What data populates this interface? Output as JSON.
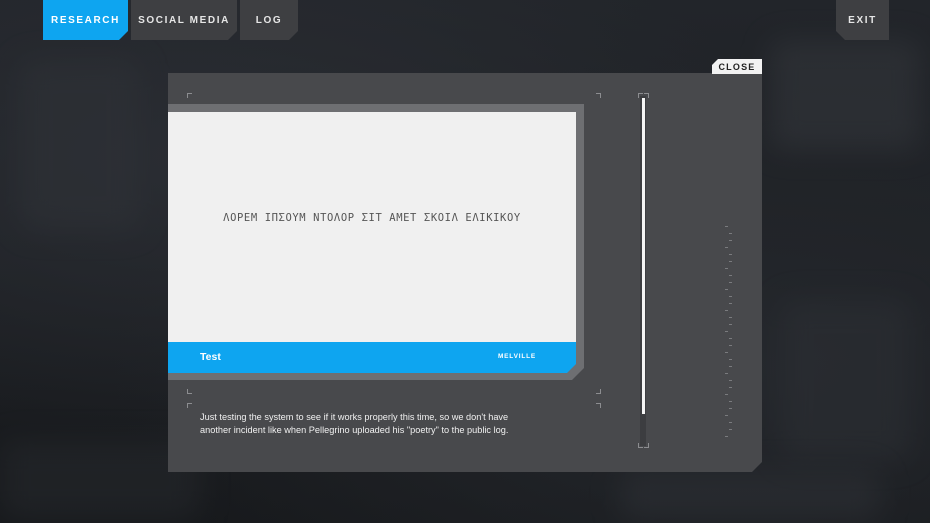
{
  "nav": {
    "tabs": [
      {
        "label": "RESEARCH",
        "active": true
      },
      {
        "label": "SOCIAL MEDIA",
        "active": false
      },
      {
        "label": "LOG",
        "active": false
      }
    ],
    "exit_label": "EXIT"
  },
  "modal": {
    "close_label": "CLOSE",
    "post": {
      "image_text": "ΛΟΡΕΜ ΙΠΣΟΥΜ ΝΤΟΛΟΡ ΣΙΤ ΑΜΕΤ ΣΚΟΙΛ ΕΛΙΚΙΚΟΥ",
      "title": "Test",
      "author": "MELVILLE",
      "description": "Just testing the system to see if it works properly this time, so we don't have another incident like when Pellegrino uploaded his \"poetry\" to the public log."
    }
  },
  "colors": {
    "accent": "#0ea5f0",
    "panel": "#48494c",
    "tab": "#3e3f42"
  }
}
